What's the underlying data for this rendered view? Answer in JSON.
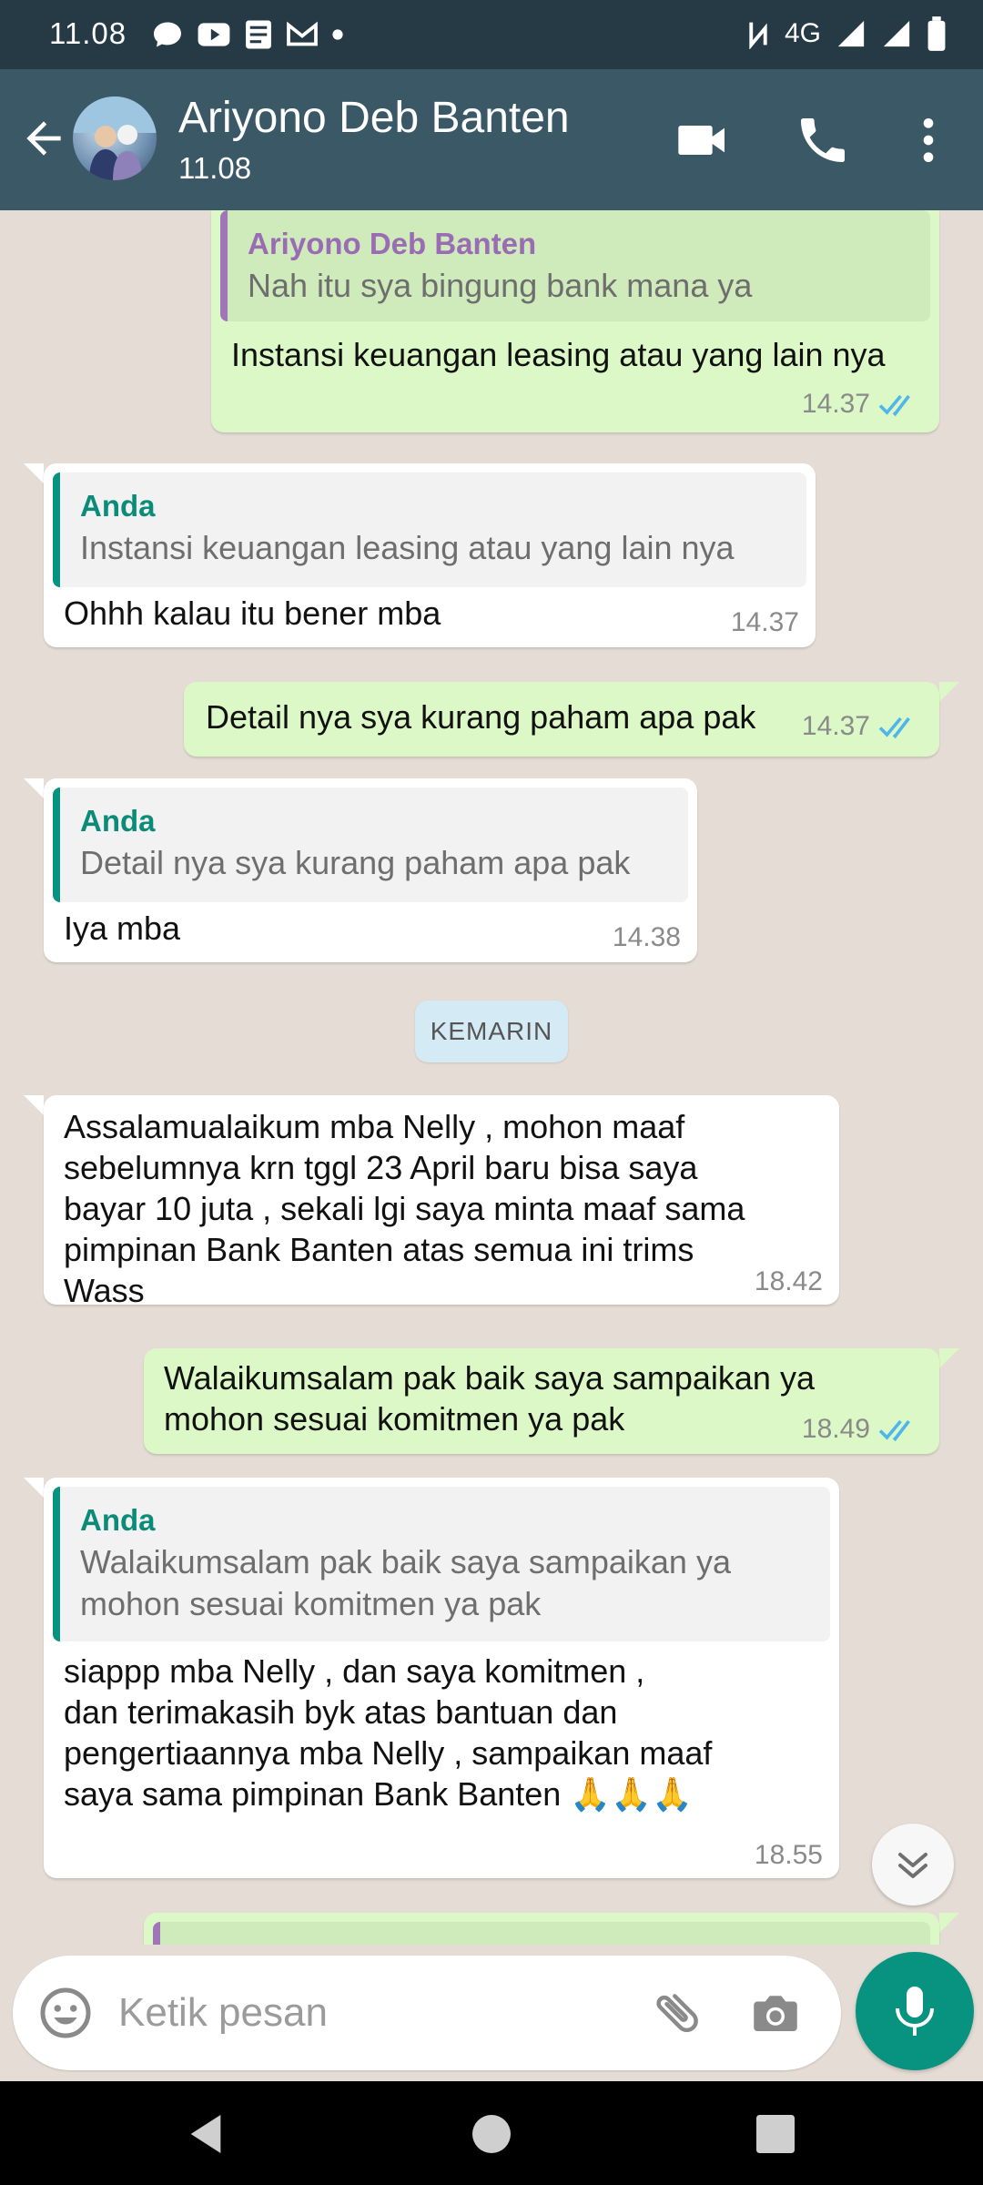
{
  "status_bar": {
    "time": "11.08",
    "network": "4G"
  },
  "header": {
    "contact_name": "Ariyono Deb Banten",
    "contact_status": "11.08"
  },
  "messages": [
    {
      "direction": "out",
      "quote_name": "Ariyono Deb Banten",
      "quote_text": "Nah itu sya bingung bank mana ya",
      "text": "Instansi keuangan leasing atau yang lain nya",
      "time": "14.37",
      "read": true
    },
    {
      "direction": "in",
      "quote_name": "Anda",
      "quote_text": "Instansi keuangan leasing atau yang lain nya",
      "text": "Ohhh kalau itu bener mba",
      "time": "14.37"
    },
    {
      "direction": "out",
      "text": "Detail nya sya kurang paham apa pak",
      "time": "14.37",
      "read": true
    },
    {
      "direction": "in",
      "quote_name": "Anda",
      "quote_text": "Detail nya sya kurang paham apa pak",
      "text": "Iya mba",
      "time": "14.38"
    },
    {
      "direction": "in",
      "text_lines": [
        "Assalamualaikum mba Nelly , mohon maaf",
        "sebelumnya krn tggl 23 April baru bisa saya",
        "bayar 10 juta , sekali lgi saya minta maaf sama",
        "pimpinan Bank Banten atas semua ini trims",
        "Wass"
      ],
      "time": "18.42"
    },
    {
      "direction": "out",
      "text_lines": [
        "Walaikumsalam pak baik saya sampaikan ya",
        "mohon sesuai komitmen ya pak"
      ],
      "time": "18.49",
      "read": true
    },
    {
      "direction": "in",
      "quote_name": "Anda",
      "quote_lines": [
        "Walaikumsalam pak baik saya sampaikan ya",
        "mohon sesuai komitmen ya pak"
      ],
      "text_lines": [
        "siappp mba Nelly , dan saya komitmen ,",
        "dan terimakasih byk atas bantuan dan",
        "pengertiaannya mba Nelly , sampaikan maaf",
        "saya sama pimpinan Bank Banten 🙏🙏🙏"
      ],
      "time": "18.55"
    }
  ],
  "date_divider": "KEMARIN",
  "composer": {
    "placeholder": "Ketik pesan"
  },
  "colors": {
    "status_bar": "#253a45",
    "app_bar": "#3a5866",
    "chat_bg": "#e5ddd5",
    "outgoing_bubble": "#dcf8c6",
    "incoming_bubble": "#ffffff",
    "accent": "#079380",
    "read_ticks": "#4fb6ec"
  }
}
